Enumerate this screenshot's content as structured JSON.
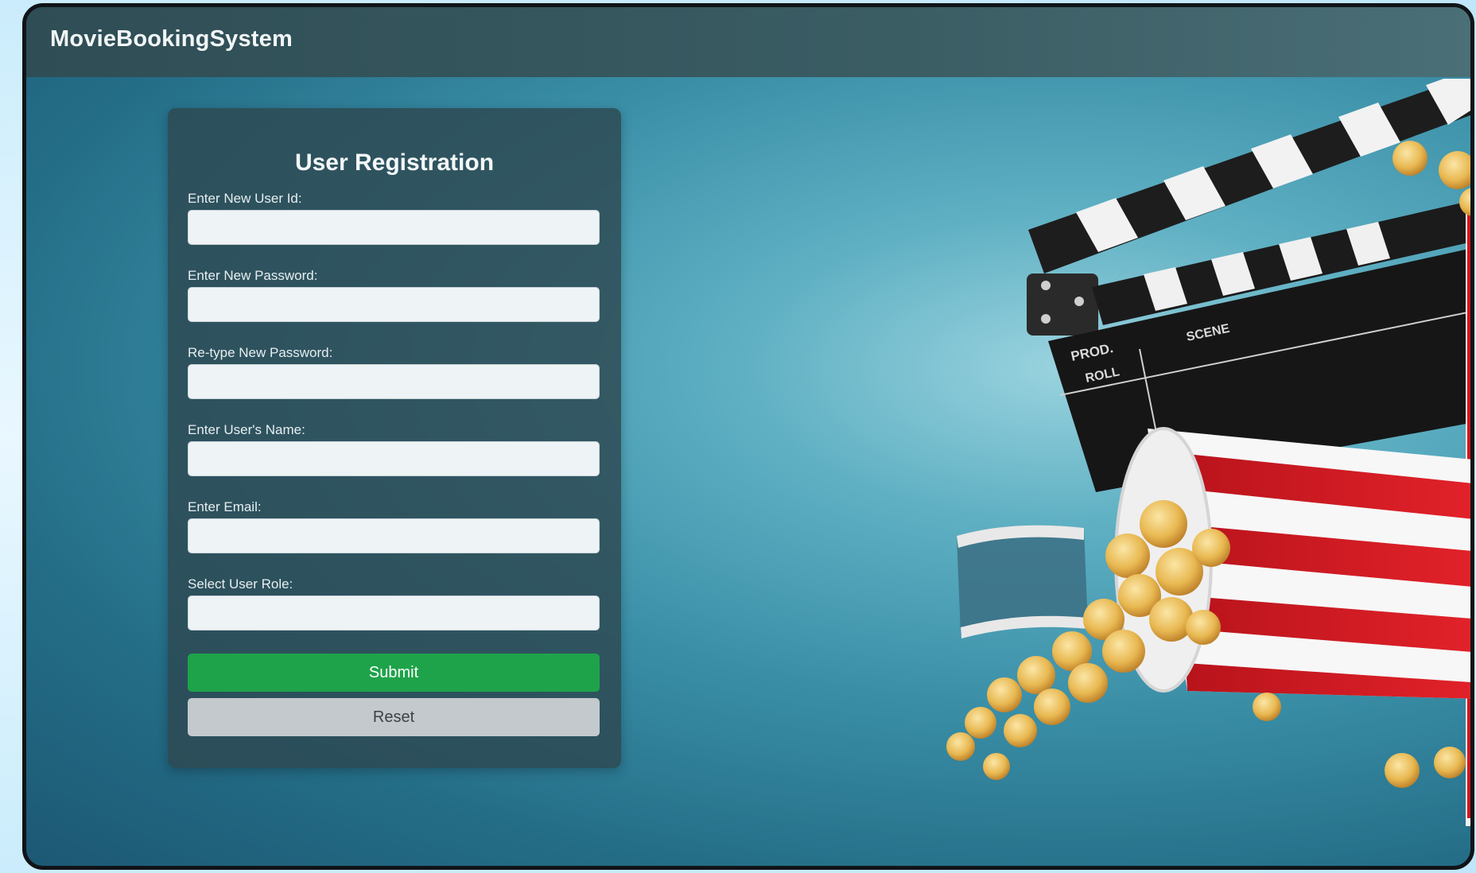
{
  "app": {
    "title": "MovieBookingSystem"
  },
  "form": {
    "title": "User Registration",
    "fields": [
      {
        "label": "Enter New User Id:",
        "value": "",
        "placeholder": ""
      },
      {
        "label": "Enter New Password:",
        "value": "",
        "placeholder": ""
      },
      {
        "label": "Re-type New Password:",
        "value": "",
        "placeholder": ""
      },
      {
        "label": "Enter User's Name:",
        "value": "",
        "placeholder": ""
      },
      {
        "label": "Enter Email:",
        "value": "",
        "placeholder": ""
      },
      {
        "label": "Select User Role:",
        "value": "",
        "placeholder": ""
      }
    ],
    "submit_label": "Submit",
    "reset_label": "Reset"
  },
  "background": {
    "clapperboard": {
      "text_prod": "PROD.",
      "text_roll": "ROLL",
      "text_scene": "SCENE"
    }
  },
  "colors": {
    "submit": "#1fa34a",
    "reset": "#c3c9cc",
    "header": "#2f4d55",
    "panel": "#2d4850"
  }
}
